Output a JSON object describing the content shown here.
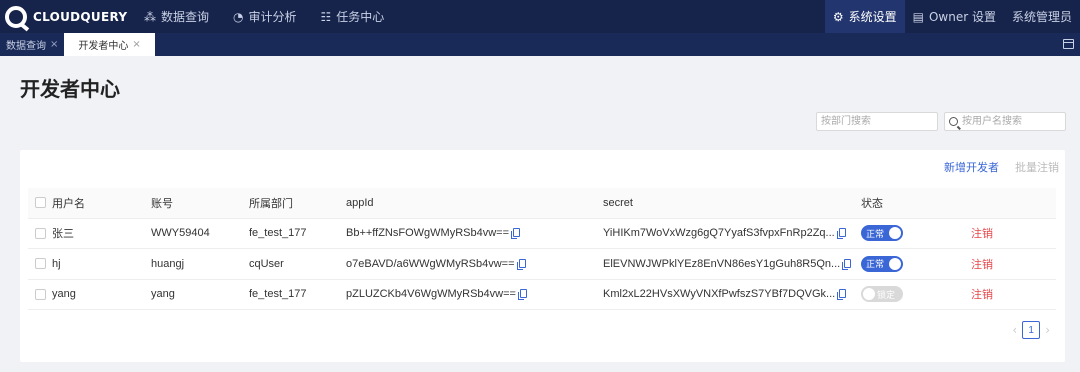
{
  "app": {
    "logo_text": "CLOUDQUERY"
  },
  "nav": {
    "left": [
      {
        "label": "数据查询",
        "icon": "database-icon"
      },
      {
        "label": "审计分析",
        "icon": "chart-icon"
      },
      {
        "label": "任务中心",
        "icon": "task-list-icon"
      }
    ],
    "right": [
      {
        "label": "系统设置",
        "icon": "user-settings-icon",
        "active": true
      },
      {
        "label": "Owner 设置",
        "icon": "owner-icon"
      },
      {
        "label": "系统管理员"
      }
    ]
  },
  "tabs": [
    {
      "label": "数据查询",
      "active": false
    },
    {
      "label": "开发者中心",
      "active": true
    }
  ],
  "page": {
    "title": "开发者中心"
  },
  "search": {
    "dept_placeholder": "按部门搜索",
    "user_placeholder": "按用户名搜索"
  },
  "actions": {
    "add": "新增开发者",
    "batch_cancel": "批量注销"
  },
  "table": {
    "headers": [
      "用户名",
      "账号",
      "所属部门",
      "appId",
      "secret",
      "状态",
      ""
    ],
    "rows": [
      {
        "user": "张三",
        "account": "WWY59404",
        "dept": "fe_test_177",
        "appid": "Bb++ffZNsFOWgWMyRSb4vw==",
        "secret": "YiHIKm7WoVxWzg6gQ7YyafS3fvpxFnRp2Zq...",
        "status": "正常",
        "enabled": true,
        "action": "注销"
      },
      {
        "user": "hj",
        "account": "huangj",
        "dept": "cqUser",
        "appid": "o7eBAVD/a6WWgWMyRSb4vw==",
        "secret": "ElEVNWJWPklYEz8EnVN86esY1gGuh8R5Qn...",
        "status": "正常",
        "enabled": true,
        "action": "注销"
      },
      {
        "user": "yang",
        "account": "yang",
        "dept": "fe_test_177",
        "appid": "pZLUZCKb4V6WgWMyRSb4vw==",
        "secret": "Kml2xL22HVsXWyVNXfPwfszS7YBf7DQVGk...",
        "status": "锁定",
        "enabled": false,
        "action": "注销"
      }
    ]
  },
  "pagination": {
    "current": "1"
  }
}
